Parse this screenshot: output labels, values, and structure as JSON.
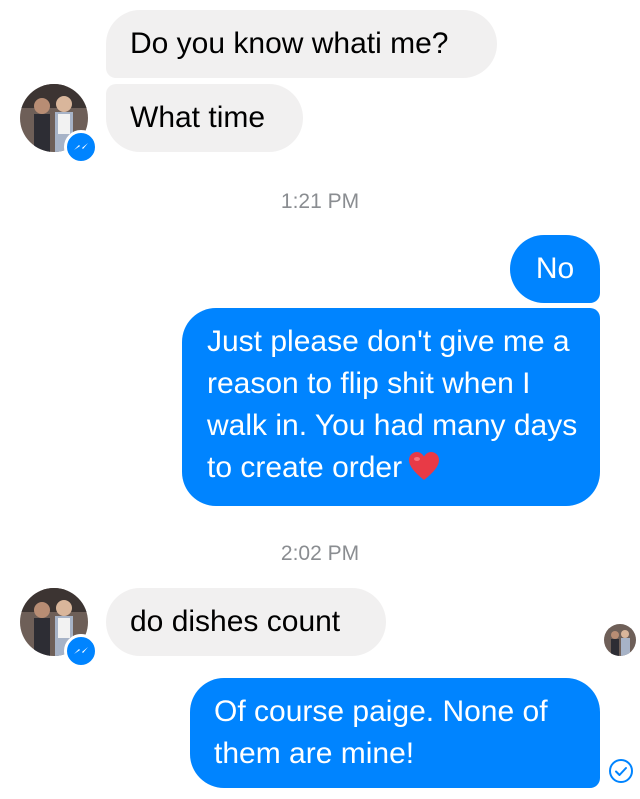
{
  "conversation": {
    "messages": [
      {
        "sender": "them",
        "text": "Do you know whati me?"
      },
      {
        "sender": "them",
        "text": "What time"
      },
      {
        "sender": "me",
        "text": "No"
      },
      {
        "sender": "me",
        "text": "Just please don't give me a reason to flip shit when I walk in. You had many days to create order"
      },
      {
        "sender": "them",
        "text": "do dishes count"
      },
      {
        "sender": "me",
        "text": "Of course paige. None of them are mine!"
      }
    ],
    "timestamps": [
      "1:21 PM",
      "2:02 PM"
    ]
  },
  "icons": {
    "emoji": "heart-emoji",
    "platform_badge": "messenger-icon",
    "delivery_status": "sent-check-icon"
  },
  "colors": {
    "incoming_bubble": "#f1f0f0",
    "outgoing_bubble": "#0084ff",
    "timestamp_text": "#8a8d91",
    "heart": "#e83a46"
  }
}
